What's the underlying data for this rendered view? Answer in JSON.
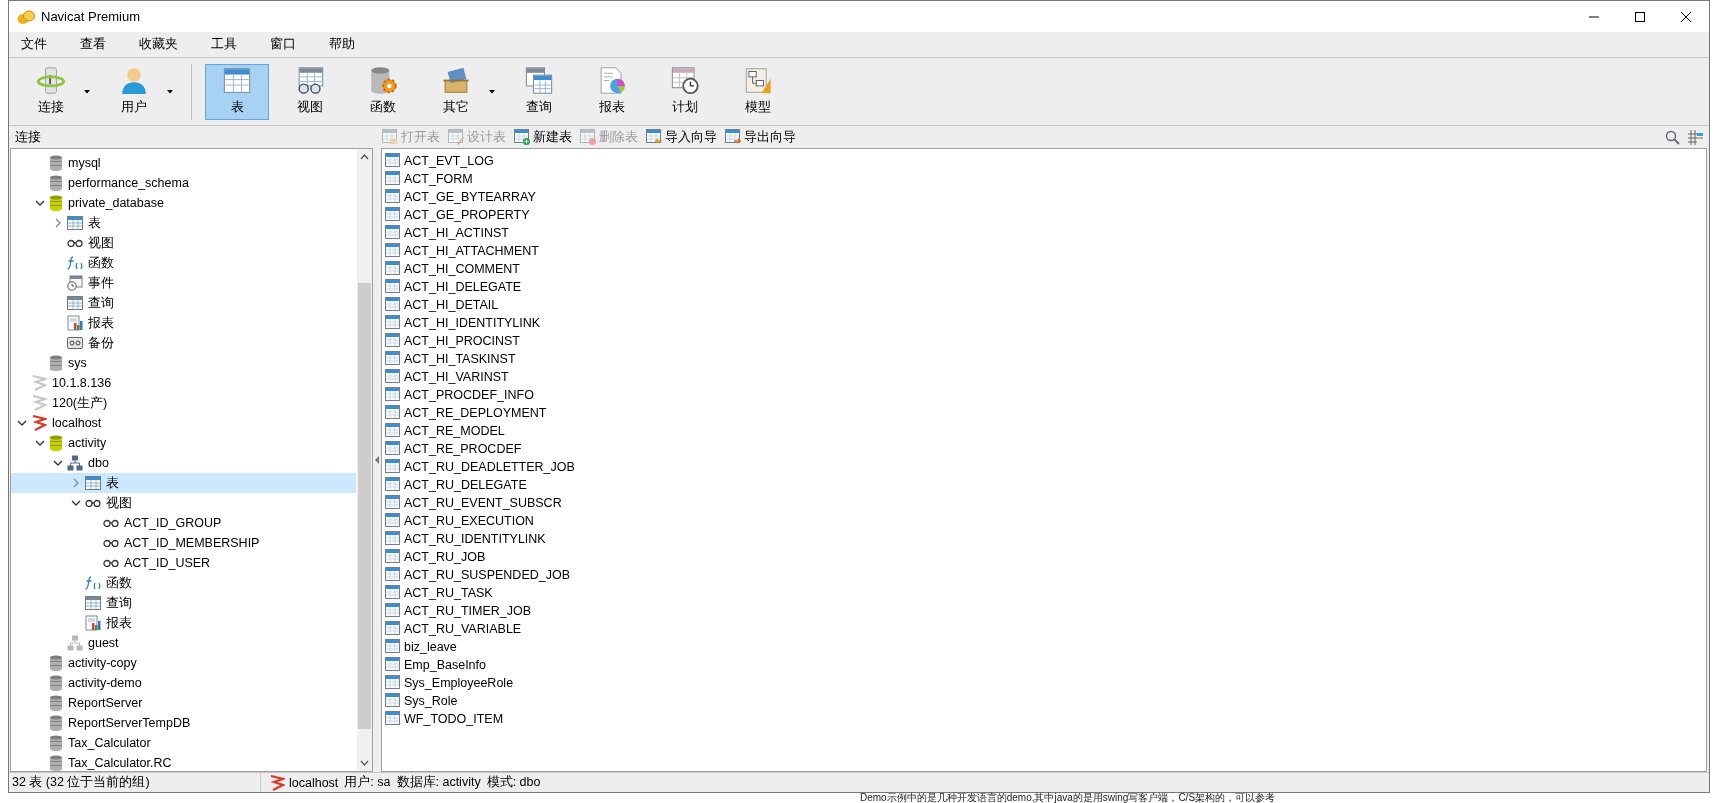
{
  "window": {
    "title": "Navicat Premium"
  },
  "menu": [
    "文件",
    "查看",
    "收藏夹",
    "工具",
    "窗口",
    "帮助"
  ],
  "toolbar": [
    {
      "label": "连接",
      "kind": "connection",
      "dropdown": true,
      "selected": false
    },
    {
      "label": "用户",
      "kind": "user",
      "dropdown": true,
      "selected": false
    },
    {
      "label": "表",
      "kind": "table",
      "dropdown": false,
      "selected": true
    },
    {
      "label": "视图",
      "kind": "view",
      "dropdown": false,
      "selected": false
    },
    {
      "label": "函数",
      "kind": "function",
      "dropdown": false,
      "selected": false
    },
    {
      "label": "其它",
      "kind": "other",
      "dropdown": true,
      "selected": false
    },
    {
      "label": "查询",
      "kind": "query",
      "dropdown": false,
      "selected": false
    },
    {
      "label": "报表",
      "kind": "report",
      "dropdown": false,
      "selected": false
    },
    {
      "label": "计划",
      "kind": "schedule",
      "dropdown": false,
      "selected": false
    },
    {
      "label": "模型",
      "kind": "model",
      "dropdown": false,
      "selected": false
    }
  ],
  "tree": {
    "title": "连接",
    "scrolled_children": [
      {
        "label": "mysql",
        "kind": "db"
      },
      {
        "label": "performance_schema",
        "kind": "db"
      },
      {
        "label": "private_database",
        "kind": "db_open",
        "expanded": true,
        "selected": false,
        "children": [
          {
            "label": "表",
            "kind": "tables",
            "expanded": false,
            "selected": false
          },
          {
            "label": "视图",
            "kind": "views"
          },
          {
            "label": "函数",
            "kind": "functions"
          },
          {
            "label": "事件",
            "kind": "events"
          },
          {
            "label": "查询",
            "kind": "queries"
          },
          {
            "label": "报表",
            "kind": "reports"
          },
          {
            "label": "备份",
            "kind": "backups"
          }
        ]
      },
      {
        "label": "sys",
        "kind": "db"
      }
    ],
    "items": [
      {
        "label": "10.1.8.136",
        "kind": "server"
      },
      {
        "label": "120(生产)",
        "kind": "server"
      },
      {
        "label": "localhost",
        "kind": "server_open",
        "expanded": true,
        "selected": false,
        "children": [
          {
            "label": "activity",
            "kind": "db_open",
            "expanded": true,
            "selected": false,
            "children": [
              {
                "label": "dbo",
                "kind": "schema",
                "expanded": true,
                "selected": false,
                "children": [
                  {
                    "label": "表",
                    "kind": "tables",
                    "expanded": false,
                    "selected": true
                  },
                  {
                    "label": "视图",
                    "kind": "views",
                    "expanded": true,
                    "selected": false,
                    "children": [
                      {
                        "label": "ACT_ID_GROUP",
                        "kind": "views"
                      },
                      {
                        "label": "ACT_ID_MEMBERSHIP",
                        "kind": "views"
                      },
                      {
                        "label": "ACT_ID_USER",
                        "kind": "views"
                      }
                    ]
                  },
                  {
                    "label": "函数",
                    "kind": "functions"
                  },
                  {
                    "label": "查询",
                    "kind": "queries"
                  },
                  {
                    "label": "报表",
                    "kind": "reports"
                  }
                ]
              },
              {
                "label": "guest",
                "kind": "schema_grey"
              }
            ]
          },
          {
            "label": "activity-copy",
            "kind": "db"
          },
          {
            "label": "activity-demo",
            "kind": "db"
          },
          {
            "label": "ReportServer",
            "kind": "db"
          },
          {
            "label": "ReportServerTempDB",
            "kind": "db"
          },
          {
            "label": "Tax_Calculator",
            "kind": "db"
          },
          {
            "label": "Tax_Calculator.RC",
            "kind": "db"
          }
        ]
      }
    ]
  },
  "object_toolbar": [
    {
      "label": "打开表",
      "kind": "open",
      "disabled": true
    },
    {
      "label": "设计表",
      "kind": "design",
      "disabled": true
    },
    {
      "label": "新建表",
      "kind": "new",
      "disabled": false
    },
    {
      "label": "删除表",
      "kind": "delete",
      "disabled": true
    },
    {
      "label": "导入向导",
      "kind": "import",
      "disabled": false
    },
    {
      "label": "导出向导",
      "kind": "export",
      "disabled": false
    }
  ],
  "tables": [
    "ACT_EVT_LOG",
    "ACT_FORM",
    "ACT_GE_BYTEARRAY",
    "ACT_GE_PROPERTY",
    "ACT_HI_ACTINST",
    "ACT_HI_ATTACHMENT",
    "ACT_HI_COMMENT",
    "ACT_HI_DELEGATE",
    "ACT_HI_DETAIL",
    "ACT_HI_IDENTITYLINK",
    "ACT_HI_PROCINST",
    "ACT_HI_TASKINST",
    "ACT_HI_VARINST",
    "ACT_PROCDEF_INFO",
    "ACT_RE_DEPLOYMENT",
    "ACT_RE_MODEL",
    "ACT_RE_PROCDEF",
    "ACT_RU_DEADLETTER_JOB",
    "ACT_RU_DELEGATE",
    "ACT_RU_EVENT_SUBSCR",
    "ACT_RU_EXECUTION",
    "ACT_RU_IDENTITYLINK",
    "ACT_RU_JOB",
    "ACT_RU_SUSPENDED_JOB",
    "ACT_RU_TASK",
    "ACT_RU_TIMER_JOB",
    "ACT_RU_VARIABLE",
    "biz_leave",
    "Emp_BaseInfo",
    "Sys_EmployeeRole",
    "Sys_Role",
    "WF_TODO_ITEM"
  ],
  "status_bar": {
    "count": "32 表 (32 位于当前的组)",
    "connection": "localhost",
    "user": "用户: sa",
    "database": "数据库: activity",
    "schema": "模式: dbo"
  },
  "background_text": "Demo示例中的是几种开发语言的demo,其中java的是用swing写客户端，C/S架构的，可以参考"
}
